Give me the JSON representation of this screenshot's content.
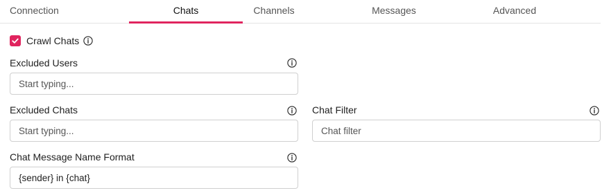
{
  "tabs": [
    {
      "label": "Connection",
      "active": false
    },
    {
      "label": "Chats",
      "active": true
    },
    {
      "label": "Channels",
      "active": false
    },
    {
      "label": "Messages",
      "active": false
    },
    {
      "label": "Advanced",
      "active": false
    }
  ],
  "crawl_chats": {
    "label": "Crawl Chats",
    "checked": true
  },
  "fields": {
    "excluded_users": {
      "label": "Excluded Users",
      "placeholder": "Start typing...",
      "value": ""
    },
    "excluded_chats": {
      "label": "Excluded Chats",
      "placeholder": "Start typing...",
      "value": ""
    },
    "chat_filter": {
      "label": "Chat Filter",
      "placeholder": "Chat filter",
      "value": ""
    },
    "chat_message_name_format": {
      "label": "Chat Message Name Format",
      "placeholder": "",
      "value": "{sender} in {chat}"
    }
  },
  "colors": {
    "accent": "#e0245e",
    "border": "#cfcfcf",
    "divider": "#e3e3e3"
  }
}
